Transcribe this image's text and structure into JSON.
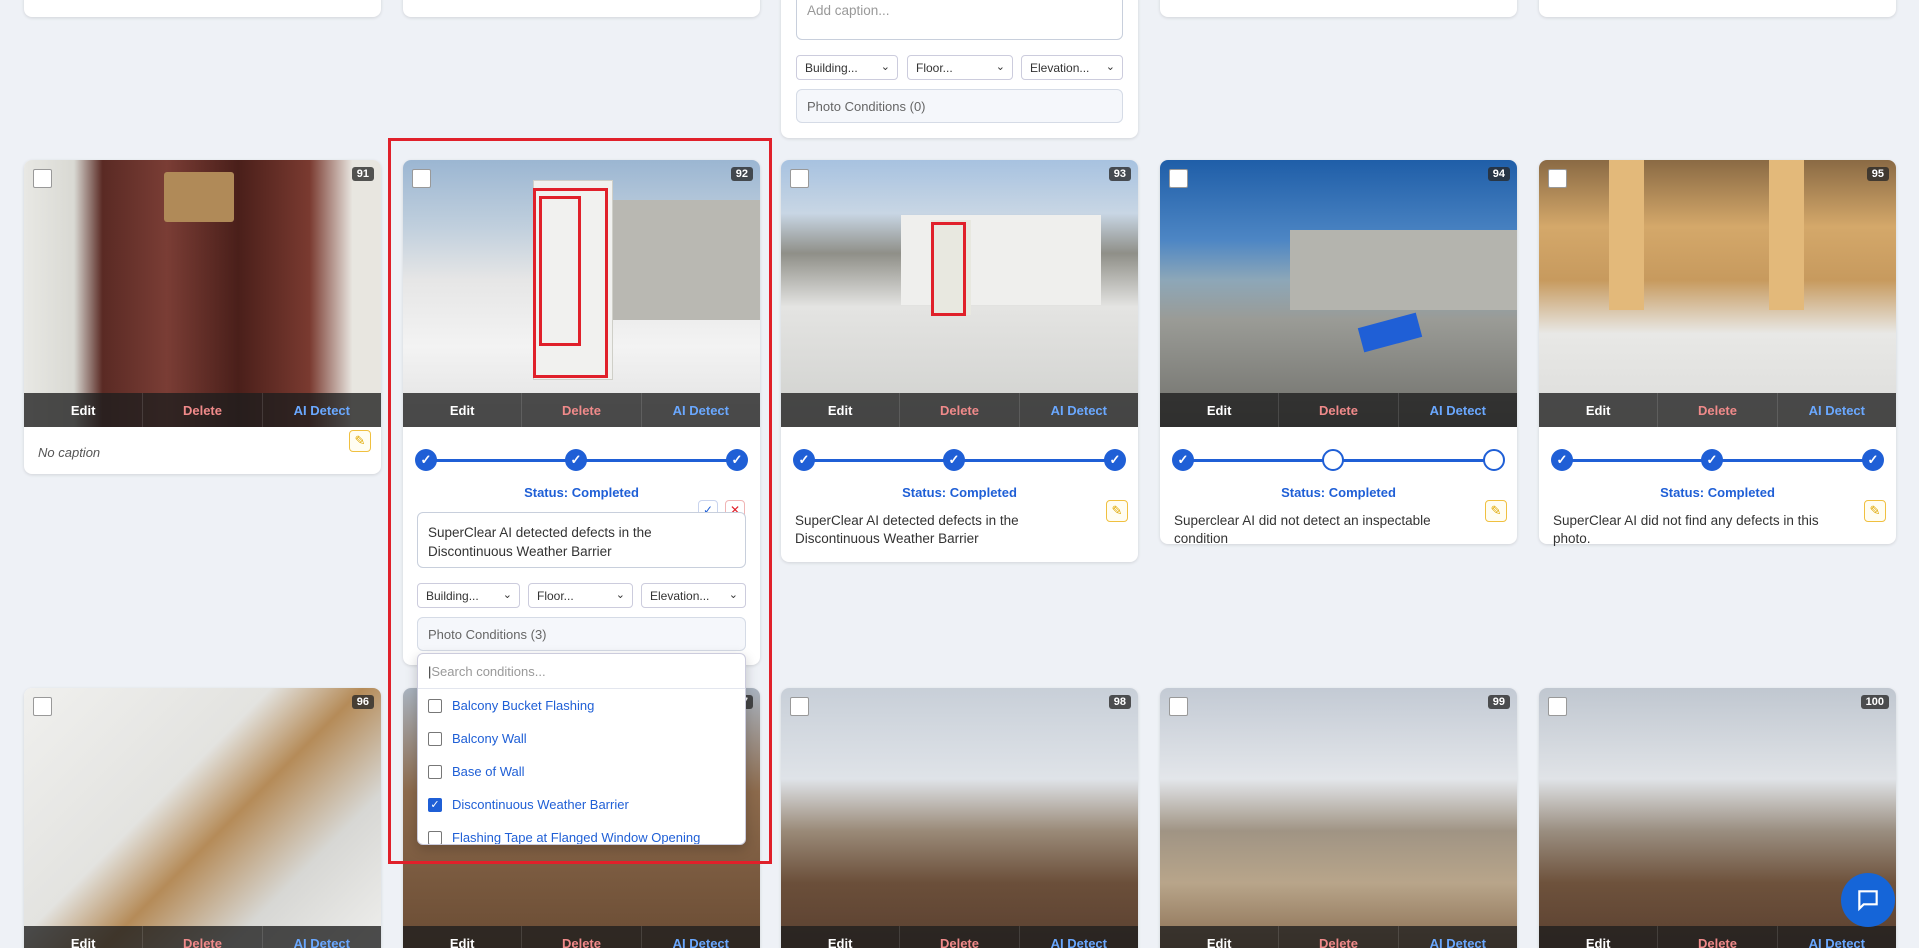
{
  "actions": {
    "edit": "Edit",
    "delete": "Delete",
    "ai": "AI Detect"
  },
  "top_card": {
    "caption_placeholder": "Add caption...",
    "building": "Building...",
    "floor": "Floor...",
    "elevation": "Elevation...",
    "conditions": "Photo Conditions (0)"
  },
  "cards": [
    {
      "number": "91",
      "status": "",
      "caption": "No caption"
    },
    {
      "number": "92",
      "status": "Status: Completed",
      "caption": "SuperClear AI detected defects in the Discontinuous Weather Barrier",
      "building": "Building...",
      "floor": "Floor...",
      "elevation": "Elevation...",
      "conditions": "Photo Conditions (3)"
    },
    {
      "number": "93",
      "status": "Status: Completed",
      "caption": "SuperClear AI detected defects in the Discontinuous Weather Barrier"
    },
    {
      "number": "94",
      "status": "Status: Completed",
      "caption": "Superclear AI did not detect an inspectable condition"
    },
    {
      "number": "95",
      "status": "Status: Completed",
      "caption": "SuperClear AI did not find any defects in this photo."
    },
    {
      "number": "96"
    },
    {
      "number": "97"
    },
    {
      "number": "98"
    },
    {
      "number": "99"
    },
    {
      "number": "100"
    }
  ],
  "dropdown": {
    "search_placeholder": "Search conditions...",
    "options": [
      {
        "label": "Balcony Bucket Flashing",
        "checked": false
      },
      {
        "label": "Balcony Wall",
        "checked": false
      },
      {
        "label": "Base of Wall",
        "checked": false
      },
      {
        "label": "Discontinuous Weather Barrier",
        "checked": true
      },
      {
        "label": "Flashing Tape at Flanged Window Opening",
        "checked": false
      }
    ]
  },
  "icons": {
    "check": "check-icon",
    "close": "close-icon",
    "pencil": "pencil-icon",
    "chat": "chat-icon"
  },
  "colors": {
    "accent": "#1f5fd6",
    "danger": "#e0202a",
    "highlight": "#e0202a"
  }
}
